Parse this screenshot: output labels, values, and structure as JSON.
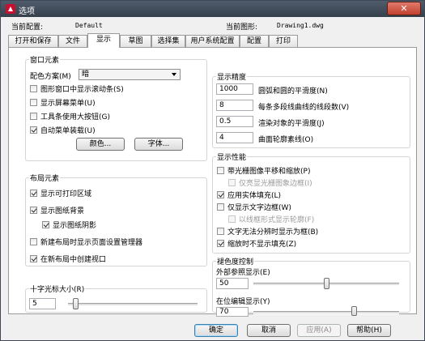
{
  "window": {
    "title": "选项",
    "close_glyph": "✕"
  },
  "header": {
    "current_profile_label": "当前配置:",
    "current_profile_value": "Default",
    "current_drawing_label": "当前图形:",
    "current_drawing_value": "Drawing1.dwg"
  },
  "tabs": [
    {
      "label": "打开和保存",
      "active": false
    },
    {
      "label": "文件",
      "active": false
    },
    {
      "label": "显示",
      "active": true
    },
    {
      "label": "草图",
      "active": false
    },
    {
      "label": "选择集",
      "active": false
    },
    {
      "label": "用户系统配置",
      "active": false
    },
    {
      "label": "配置",
      "active": false
    },
    {
      "label": "打印",
      "active": false
    }
  ],
  "window_elements": {
    "title": "窗口元素",
    "color_scheme_label": "配色方案(M)",
    "color_scheme_value": "暗",
    "checkboxes": [
      {
        "label": "图形窗口中显示滚动条(S)",
        "checked": false,
        "disabled": false
      },
      {
        "label": "显示屏幕菜单(U)",
        "checked": false,
        "disabled": false
      },
      {
        "label": "工具条使用大按钮(G)",
        "checked": false,
        "disabled": false
      },
      {
        "label": "自动菜单装载(U)",
        "checked": true,
        "disabled": false
      }
    ],
    "colors_button": "颜色...",
    "fonts_button": "字体..."
  },
  "layout_elements": {
    "title": "布局元素",
    "checkboxes": [
      {
        "label": "显示可打印区域",
        "checked": true,
        "disabled": false
      },
      {
        "label": "显示图纸背景",
        "checked": true,
        "disabled": false
      },
      {
        "label": "显示图纸阴影",
        "checked": true,
        "disabled": false
      },
      {
        "label": "新建布局时显示页面设置管理器",
        "checked": false,
        "disabled": false
      },
      {
        "label": "在新布局中创建视口",
        "checked": true,
        "disabled": false
      }
    ]
  },
  "crosshair": {
    "title": "十字光标大小(R)",
    "value": "5",
    "slider_fraction": 0.04
  },
  "display_resolution": {
    "title": "显示精度",
    "rows": [
      {
        "value": "1000",
        "label": "圆弧和圆的平滑度(N)"
      },
      {
        "value": "8",
        "label": "每条多段线曲线的线段数(V)"
      },
      {
        "value": "0.5",
        "label": "渲染对象的平滑度(J)"
      },
      {
        "value": "4",
        "label": "曲面轮廓素线(O)"
      }
    ]
  },
  "display_performance": {
    "title": "显示性能",
    "checkboxes": [
      {
        "label": "带光栅图像平移和缩放(P)",
        "checked": false,
        "disabled": false
      },
      {
        "label": "仅亮显光栅图象边框(I)",
        "checked": false,
        "disabled": true
      },
      {
        "label": "应用实体填充(L)",
        "checked": true,
        "disabled": false
      },
      {
        "label": "仅显示文字边框(W)",
        "checked": false,
        "disabled": false
      },
      {
        "label": "以线框形式显示轮廓(F)",
        "checked": false,
        "disabled": true
      },
      {
        "label": "文字无法分辨时显示为框(B)",
        "checked": false,
        "disabled": false
      },
      {
        "label": "缩放时不显示填充(Z)",
        "checked": true,
        "disabled": false
      }
    ]
  },
  "fade_control": {
    "title": "褪色度控制",
    "xref_label": "外部参照显示(E)",
    "xref_value": "50",
    "xref_fraction": 0.5,
    "inplace_label": "在位编辑显示(Y)",
    "inplace_value": "70",
    "inplace_fraction": 0.7
  },
  "footer": {
    "ok": "确定",
    "cancel": "取消",
    "apply": "应用(A)",
    "help": "帮助(H)"
  }
}
